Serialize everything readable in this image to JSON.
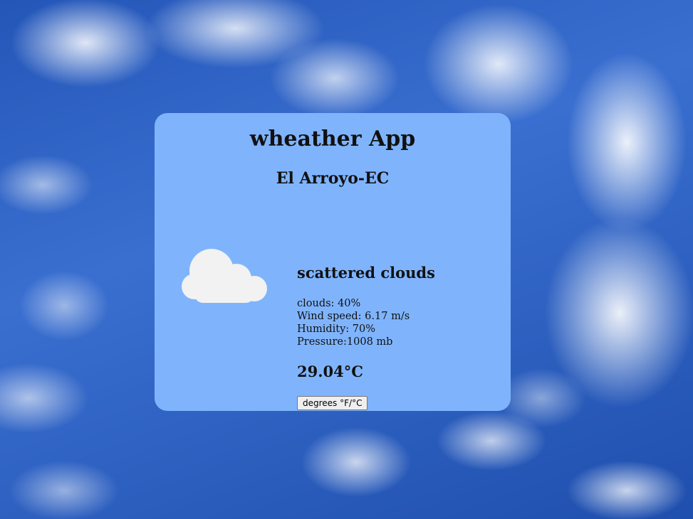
{
  "app": {
    "title": "wheather App",
    "city": "El Arroyo-EC"
  },
  "weather": {
    "icon": "scattered-clouds-icon",
    "description": "scattered clouds",
    "clouds": "clouds: 40%",
    "wind_speed": "Wind speed: 6.17 m/s",
    "humidity": "Humidity: 70%",
    "pressure": "Pressure:1008 mb",
    "temperature": "29.04°C"
  },
  "controls": {
    "unit_toggle_label": "degrees °F/°C"
  },
  "colors": {
    "card_background": "#7fb4fd",
    "sky_blue": "#2f62c4",
    "cloud_white": "#f2f2f2"
  }
}
